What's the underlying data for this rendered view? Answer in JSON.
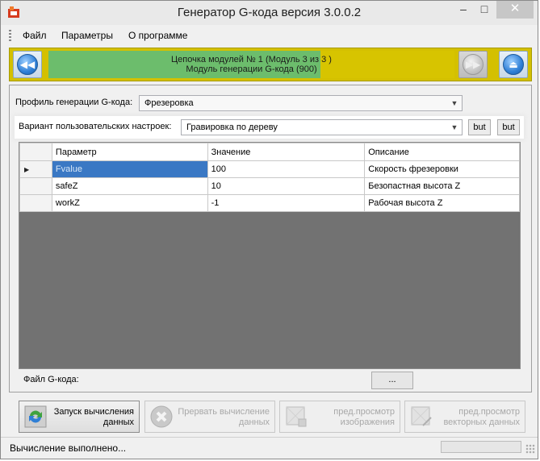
{
  "window": {
    "title": "Генератор G-кода версия 3.0.0.2",
    "controls": {
      "minimize": "‒",
      "maximize": "□",
      "close": "✕"
    }
  },
  "menu": [
    "Файл",
    "Параметры",
    "О программе"
  ],
  "chain": {
    "line1": "Цепочка модулей № 1 (Модуль 3 из 3 )",
    "line2": "Модуль генерации G-кода (900)",
    "progress": 0.67,
    "prev_icon": "rewind-icon",
    "next_icon": "fast-forward-icon",
    "eject_icon": "eject-icon"
  },
  "profile": {
    "label": "Профиль генерации G-кода:",
    "value": "Фрезеровка"
  },
  "variant": {
    "label": "Вариант пользовательских настроек:",
    "value": "Гравировка по дереву",
    "btn1": "but",
    "btn2": "but"
  },
  "grid": {
    "columns": [
      "Параметр",
      "Значение",
      "Описание"
    ],
    "rows": [
      {
        "param": "Fvalue",
        "value": "100",
        "desc": "Скорость фрезеровки"
      },
      {
        "param": "safeZ",
        "value": "10",
        "desc": "Безопастная высота Z"
      },
      {
        "param": "workZ",
        "value": "-1",
        "desc": "Рабочая высота Z"
      }
    ]
  },
  "file": {
    "label": "Файл G-кода:",
    "button": "..."
  },
  "actions": {
    "run": {
      "line1": "Запуск вычисления",
      "line2": "данных"
    },
    "stop": {
      "line1": "Прервать вычисление",
      "line2": "данных"
    },
    "preview_img": {
      "line1": "пред.просмотр",
      "line2": "изображения"
    },
    "preview_vec": {
      "line1": "пред.просмотр",
      "line2": "векторных данных"
    }
  },
  "status": {
    "text": "Вычисление выполнено..."
  },
  "colors": {
    "progress_done": "#6cbd6c",
    "progress_rest": "#d7c400",
    "selection": "#3a78c4",
    "grid_bg": "#727272"
  }
}
